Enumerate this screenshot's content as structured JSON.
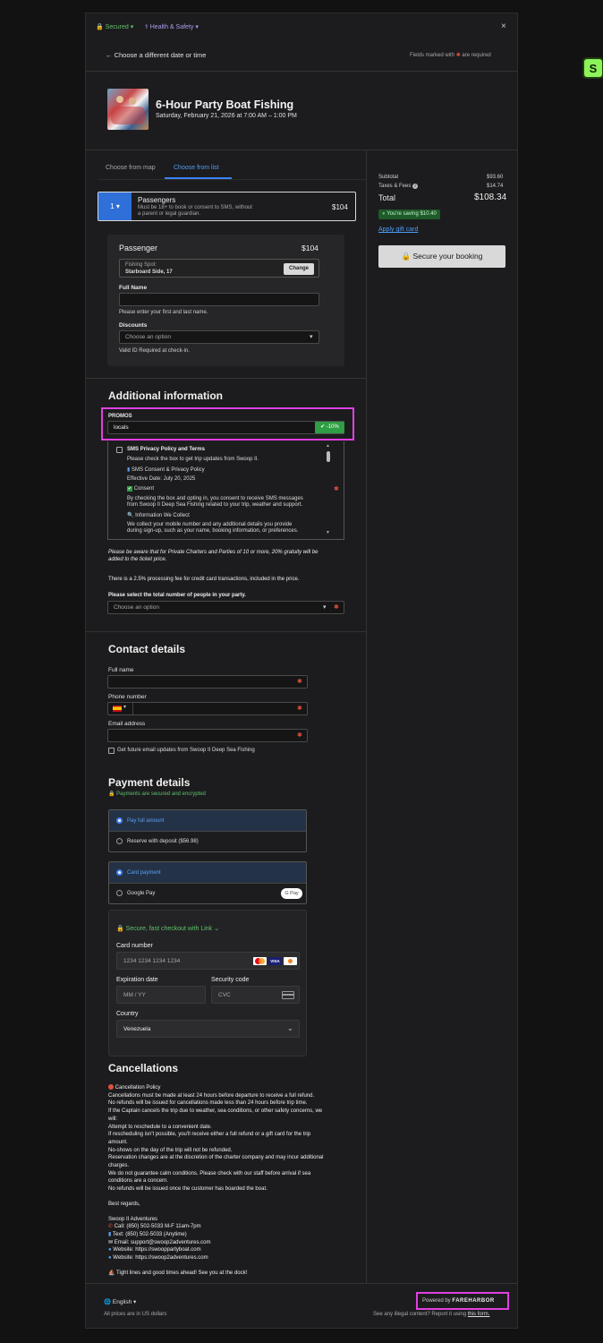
{
  "header": {
    "secured_label": "Secured",
    "health_label": "Health & Safety",
    "back_label": "Choose a different date or time",
    "required_note_pre": "Fields marked with",
    "required_note_post": "are required"
  },
  "trip": {
    "title": "6-Hour Party Boat Fishing",
    "datetime": "Saturday, February 21, 2026 at 7:00 AM – 1:00 PM"
  },
  "tabs": [
    {
      "label": "Choose from map",
      "active": false
    },
    {
      "label": "Choose from list",
      "active": true
    }
  ],
  "passengers": {
    "count": "1",
    "title": "Passengers",
    "desc_line1": "Must be 18+ to book or consent to SMS, without",
    "desc_line2": "a parent or legal guardian.",
    "price": "$104"
  },
  "passenger_card": {
    "title": "Passenger",
    "price": "$104",
    "fishing_spot_label": "Fishing Spot:",
    "fishing_spot_value": "Starboard Side, 17",
    "change_label": "Change",
    "fullname_label": "Full Name",
    "fullname_help": "Please enter your first and last name.",
    "discounts_label": "Discounts",
    "discounts_placeholder": "Choose an option",
    "discounts_help": "Valid ID Required at check-in."
  },
  "additional": {
    "title": "Additional information",
    "promos_label": "PROMOS",
    "promo_value": "locals",
    "promo_badge": "-10%",
    "sms_title": "SMS Privacy Policy and Terms",
    "sms_line1": "Please check the box to get trip updates from Swoop II.",
    "sms_line2": "SMS Consent & Privacy Policy",
    "sms_line3": "Effective Date: July 20, 2025",
    "sms_line4": "Consent",
    "sms_line5": "By checking the box and opting in, you consent to receive SMS messages",
    "sms_line6": "from Swoop II Deep Sea Fishing related to your trip, weather and support.",
    "sms_line7": "Information We Collect",
    "sms_line8": "We collect your mobile number and any additional details you provide",
    "sms_line9": "during sign-up, such as your name, booking information, or preferences.",
    "notice1_line1": "Please be aware that for Private Charters and Parties of 10 or more, 20% gratuity will be",
    "notice1_line2": "added to the ticket price.",
    "notice2": "There is a 2.5% processing fee for credit card transactions, included in the price.",
    "party_label": "Please select the total number of people in your party.",
    "party_placeholder": "Choose an option"
  },
  "contact": {
    "title": "Contact details",
    "fullname_label": "Full name",
    "phone_label": "Phone number",
    "email_label": "Email address",
    "updates_label": "Get future email updates from Swoop II Deep Sea Fishing"
  },
  "payment": {
    "title": "Payment details",
    "secure_note": "Payments are secured and encrypted",
    "pay_full": "Pay full amount",
    "reserve": "Reserve with deposit ($56.98)",
    "card_payment": "Card payment",
    "google_pay": "Google Pay",
    "gpay_badge": "G Pay",
    "link_label": "Secure, fast checkout with Link",
    "card_number_label": "Card number",
    "card_number_placeholder": "1234 1234 1234 1234",
    "visa": "VISA",
    "exp_label": "Expiration date",
    "exp_placeholder": "MM / YY",
    "cvc_label": "Security code",
    "cvc_placeholder": "CVC",
    "country_label": "Country",
    "country_value": "Venezuela"
  },
  "cancellations": {
    "title": "Cancellations",
    "lines": [
      "Cancellation Policy",
      "Cancellations must be made at least 24 hours before departure to receive a full refund.",
      "No refunds will be issued for cancellations made less than 24 hours before trip time.",
      "If the Captain cancels the trip due to weather, sea conditions, or other safety concerns, we",
      "will:",
      "Attempt to reschedule to a convenient date.",
      "If rescheduling isn't possible, you'll receive either a full refund or a gift card for the trip",
      "amount.",
      "No-shows on the day of the trip will not be refunded.",
      "Reservation changes are at the discretion of the charter company and may incur additional",
      "charges.",
      "We do not guarantee calm conditions. Please check with our staff before arrival if sea",
      "conditions are a concern.",
      "No refunds will be issued once the customer has boarded the boat."
    ],
    "regards": "Best regards,",
    "company": "Swoop II Adventures",
    "contacts": [
      "Call: (850) 502-5033 M-F 11am-7pm",
      "Text: (850) 502-5033 (Anytime)",
      "Email: support@swoop2adventures.com",
      "Website: https://swooppartyboat.com",
      "Website: https://swoop2adventures.com"
    ],
    "signoff": "Tight lines and good times ahead! See you at the dock!"
  },
  "summary": {
    "subtotal_label": "Subtotal",
    "subtotal_value": "$93.60",
    "taxes_label": "Taxes & Fees",
    "taxes_value": "$14.74",
    "total_label": "Total",
    "total_value": "$108.34",
    "saving": "You're saving $10.40",
    "gift_card": "Apply gift card",
    "secure_button": "Secure your booking"
  },
  "footer": {
    "language": "English",
    "currency_note": "All prices are in US dollars",
    "powered_by": "Powered by",
    "brand": "FAREHARBOR",
    "report_pre": "See any illegal content? Report it using",
    "report_link": "this form."
  },
  "colors": {
    "accent_blue": "#3b82f6",
    "promo_highlight": "#e040e0",
    "success_green": "#2f9e44",
    "sidebar_badge": "#8cf35a"
  }
}
